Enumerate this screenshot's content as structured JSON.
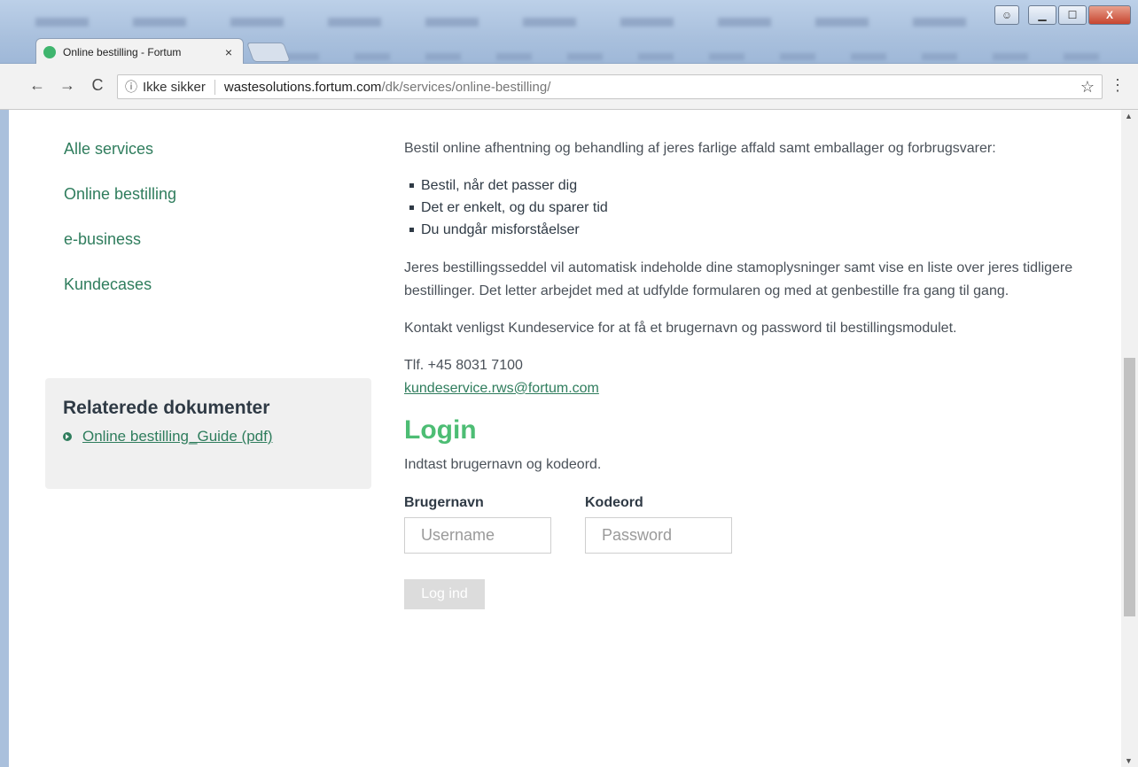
{
  "browser": {
    "tab_title": "Online bestilling - Fortum",
    "tab_close": "×",
    "back": "←",
    "forward": "→",
    "reload": "C",
    "security_label": "Ikke sikker",
    "url_host": "wastesolutions.fortum.com",
    "url_path": "/dk/services/online-bestilling/",
    "bookmark": "☆",
    "menu": "⋮",
    "window_buttons": {
      "minimize": "▁",
      "maximize": "☐",
      "close": "X"
    }
  },
  "sidebar": {
    "items": [
      {
        "label": "Alle services"
      },
      {
        "label": "Online bestilling"
      },
      {
        "label": "e-business"
      },
      {
        "label": "Kundecases"
      }
    ],
    "related": {
      "title": "Relaterede dokumenter",
      "doc_label": "Online bestilling_Guide (pdf)"
    }
  },
  "main": {
    "intro": "Bestil online afhentning og behandling af jeres farlige affald samt emballager og forbrugsvarer:",
    "bullets": [
      "Bestil, når det passer dig",
      "Det er enkelt, og du sparer tid",
      "Du undgår misforståelser"
    ],
    "paragraph2": "Jeres bestillingsseddel vil automatisk indeholde dine stamoplysninger samt vise en liste over jeres tidligere bestillinger. Det letter arbejdet med at udfylde formularen og med at genbestille fra gang til gang.",
    "paragraph3": "Kontakt venligst Kundeservice for at få et brugernavn og password til bestillingsmodulet.",
    "phone": "Tlf. +45 8031 7100",
    "email": "kundeservice.rws@fortum.com",
    "login": {
      "heading": "Login",
      "instruction": "Indtast brugernavn og kodeord.",
      "username_label": "Brugernavn",
      "username_placeholder": "Username",
      "password_label": "Kodeord",
      "password_placeholder": "Password",
      "submit_label": "Log ind"
    }
  },
  "colors": {
    "link_green": "#2f7d5d",
    "heading_green": "#4dbd74",
    "text": "#4a5159"
  }
}
